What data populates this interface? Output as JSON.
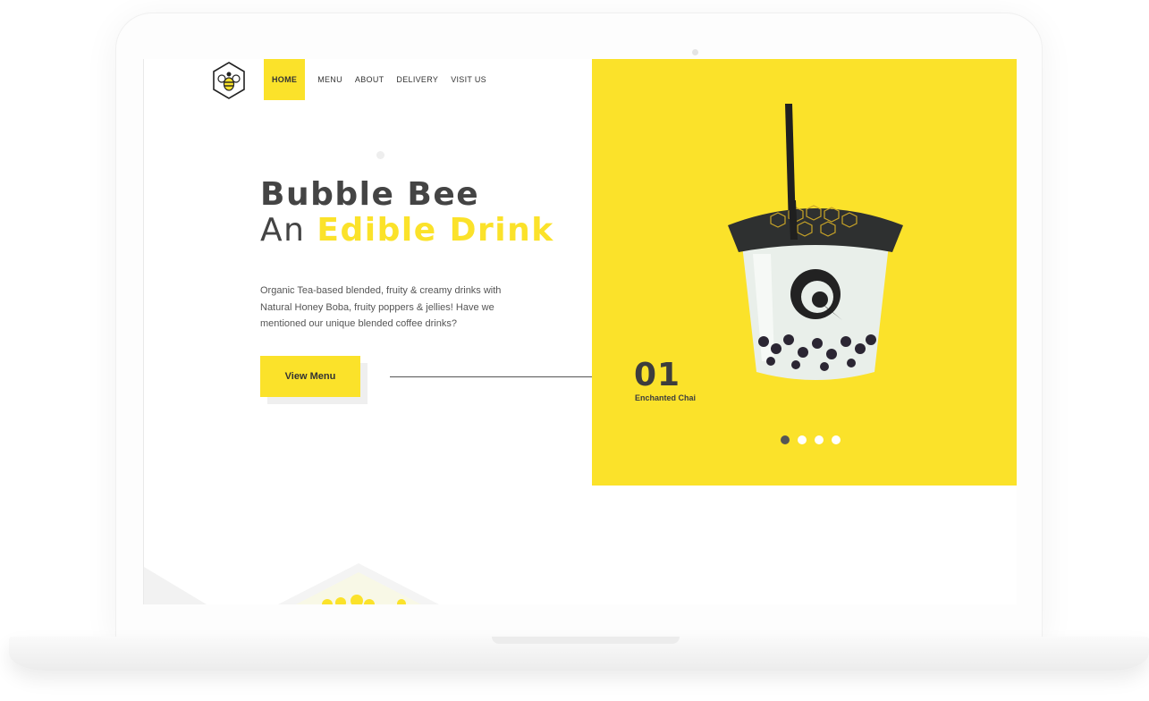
{
  "nav": {
    "items": [
      {
        "label": "HOME",
        "active": true
      },
      {
        "label": "MENU",
        "active": false
      },
      {
        "label": "ABOUT",
        "active": false
      },
      {
        "label": "DELIVERY",
        "active": false
      },
      {
        "label": "VISIT US",
        "active": false
      }
    ]
  },
  "hero": {
    "title_line1": "Bubble Bee",
    "title_line2_prefix": "An ",
    "title_line2_accent": "Edible Drink",
    "description": "Organic Tea-based blended, fruity & creamy drinks with Natural Honey Boba, fruity poppers & jellies! Have we mentioned our unique blended coffee drinks?",
    "cta_label": "View Menu"
  },
  "slider": {
    "number": "01",
    "name": "Enchanted Chai",
    "dots": [
      true,
      false,
      false,
      false
    ]
  },
  "colors": {
    "accent": "#fbe22a",
    "text_dark": "#444444",
    "dot_active": "#555555"
  },
  "icons": [
    "bee-logo-icon",
    "bubble-tea-cup-image"
  ]
}
